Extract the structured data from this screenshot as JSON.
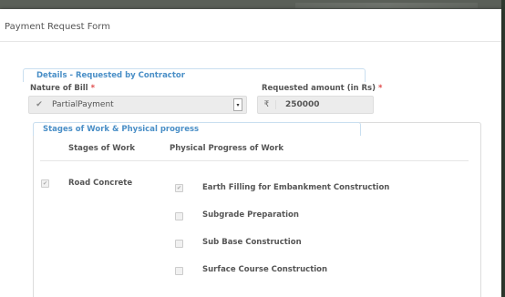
{
  "modal": {
    "title": "Payment Request Form"
  },
  "details": {
    "legend": "Details - Requested by Contractor",
    "nature_label": "Nature of Bill",
    "required_mark": "*",
    "nature_value": "PartialPayment",
    "amount_label": "Requested amount (in Rs)",
    "currency_symbol": "₹",
    "amount_value": "250000"
  },
  "stages": {
    "legend": "Stages of Work & Physical progress",
    "col_stages": "Stages of Work",
    "col_progress": "Physical Progress of Work",
    "stage_name": "Road Concrete",
    "stage_checked": true,
    "progress_items": [
      {
        "label": "Earth Filling for Embankment Construction",
        "checked": true
      },
      {
        "label": "Subgrade Preparation",
        "checked": false
      },
      {
        "label": "Sub Base Construction",
        "checked": false
      },
      {
        "label": "Surface Course Construction",
        "checked": false
      }
    ]
  },
  "icons": {
    "check": "check-icon",
    "dropdown": "chevron-down-icon"
  }
}
